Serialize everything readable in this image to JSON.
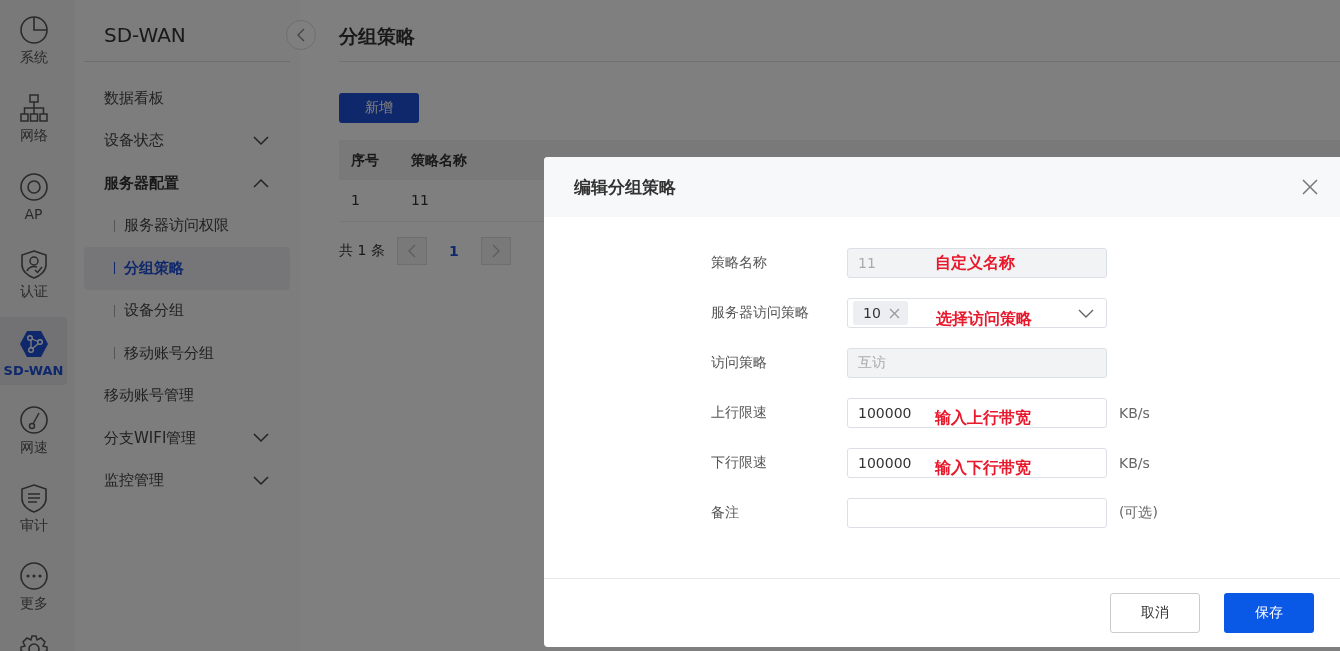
{
  "rail": [
    {
      "label": "系统",
      "selected": false
    },
    {
      "label": "网络",
      "selected": false
    },
    {
      "label": "AP",
      "selected": false
    },
    {
      "label": "认证",
      "selected": false
    },
    {
      "label": "SD-WAN",
      "selected": true
    },
    {
      "label": "网速",
      "selected": false
    },
    {
      "label": "审计",
      "selected": false
    },
    {
      "label": "更多",
      "selected": false
    },
    {
      "selected": false
    }
  ],
  "sidebar": {
    "title": "SD-WAN",
    "items": [
      {
        "label": "数据看板"
      },
      {
        "label": "设备状态",
        "expanded": false
      },
      {
        "label": "服务器配置",
        "expanded": true,
        "children": [
          {
            "label": "服务器访问权限",
            "selected": false
          },
          {
            "label": "分组策略",
            "selected": true
          },
          {
            "label": "设备分组",
            "selected": false
          },
          {
            "label": "移动账号分组",
            "selected": false
          }
        ]
      },
      {
        "label": "移动账号管理"
      },
      {
        "label": "分支WIFI管理",
        "expanded": false
      },
      {
        "label": "监控管理",
        "expanded": false
      }
    ]
  },
  "page": {
    "title": "分组策略",
    "add_button": "新增",
    "table": {
      "columns": [
        "序号",
        "策略名称"
      ],
      "rows": [
        [
          "1",
          "11"
        ]
      ]
    },
    "pagination": {
      "total": "共 1 条",
      "pages": [
        {
          "label": "1",
          "selected": true
        }
      ]
    }
  },
  "dialog": {
    "title": "编辑分组策略",
    "fields": [
      {
        "label": "策略名称",
        "kind": "input",
        "value": "11",
        "disabled": true,
        "annotation": "自定义名称"
      },
      {
        "label": "服务器访问策略",
        "kind": "select",
        "tags": [
          "10"
        ],
        "annotation": "选择访问策略"
      },
      {
        "label": "访问策略",
        "kind": "input",
        "value": "互访",
        "disabled": true
      },
      {
        "label": "上行限速",
        "kind": "input",
        "value": "100000",
        "disabled": false,
        "annotation": "输入上行带宽",
        "suffix": "KB/s"
      },
      {
        "label": "下行限速",
        "kind": "input",
        "value": "100000",
        "disabled": false,
        "annotation": "输入下行带宽",
        "suffix": "KB/s"
      },
      {
        "label": "备注",
        "kind": "input",
        "disabled": false,
        "suffix": "(可选)"
      }
    ],
    "buttons": [
      {
        "label": "取消",
        "kind": "secondary"
      },
      {
        "label": "保存",
        "kind": "primary"
      }
    ]
  }
}
